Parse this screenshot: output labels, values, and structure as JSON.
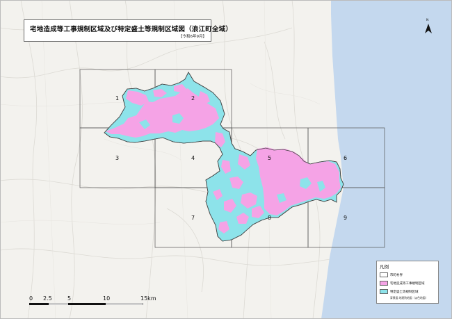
{
  "map": {
    "title": "宅地造成等工事規制区域及び特定盛土等規制区域図（浪江町全域）",
    "subtitle": "【令和6年9月】",
    "north_label": "N",
    "grid_labels": [
      "1",
      "2",
      "3",
      "4",
      "5",
      "6",
      "7",
      "8",
      "9"
    ],
    "legend": {
      "title": "凡例",
      "items": [
        {
          "label": "市町村界",
          "color": "#ffffff"
        },
        {
          "label": "宅地造成等工事規制区域",
          "color": "#f5a3e6"
        },
        {
          "label": "特定盛土等規制区域",
          "color": "#8de3ea"
        }
      ],
      "note": "背景図 地理院地図（淡色地図）"
    },
    "scale": {
      "labels": [
        "0",
        "2.5",
        "5",
        "10",
        "15km"
      ]
    },
    "colors": {
      "sea": "#c4d8ee",
      "land": "#f3f2ee",
      "tokutei": "#8de3ea",
      "takuchi": "#f5a3e6",
      "boundary": "#444444"
    }
  }
}
